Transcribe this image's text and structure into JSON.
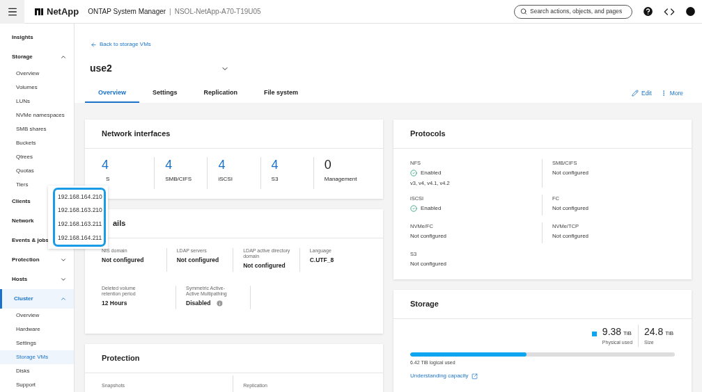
{
  "header": {
    "brand": "NetApp",
    "product": "ONTAP System Manager",
    "separator": "|",
    "cluster": "NSOL-NetApp-A70-T19U05",
    "search": {
      "placeholder": "Search actions, objects, and pages"
    }
  },
  "sidebar": {
    "items": [
      {
        "label": "Insights",
        "selected": false
      },
      {
        "label": "Storage",
        "selected": false,
        "expanded": true,
        "children": [
          {
            "label": "Overview",
            "selected": false
          },
          {
            "label": "Volumes",
            "selected": false
          },
          {
            "label": "LUNs",
            "selected": false
          },
          {
            "label": "NVMe namespaces",
            "selected": false
          },
          {
            "label": "SMB shares",
            "selected": false
          },
          {
            "label": "Buckets",
            "selected": false
          },
          {
            "label": "Qtrees",
            "selected": false
          },
          {
            "label": "Quotas",
            "selected": false
          },
          {
            "label": "Tiers",
            "selected": false
          }
        ]
      },
      {
        "label": "Clients",
        "selected": false
      },
      {
        "label": "Network",
        "selected": false
      },
      {
        "label": "Events & jobs",
        "selected": false
      },
      {
        "label": "Protection",
        "selected": false,
        "expanded": false
      },
      {
        "label": "Hosts",
        "selected": false,
        "expanded": false
      },
      {
        "label": "Cluster",
        "selected": true,
        "expanded": true,
        "children": [
          {
            "label": "Overview",
            "selected": false
          },
          {
            "label": "Hardware",
            "selected": false
          },
          {
            "label": "Settings",
            "selected": false
          },
          {
            "label": "Storage VMs",
            "selected": true
          },
          {
            "label": "Disks",
            "selected": false
          },
          {
            "label": "Support",
            "selected": false
          }
        ]
      }
    ]
  },
  "page": {
    "back_link": "Back to storage VMs",
    "title": "use2",
    "tabs": [
      {
        "label": "Overview",
        "selected": true
      },
      {
        "label": "Settings",
        "selected": false
      },
      {
        "label": "Replication",
        "selected": false
      },
      {
        "label": "File system",
        "selected": false
      }
    ],
    "actions": [
      {
        "kind": "edit",
        "label": "Edit"
      },
      {
        "kind": "more",
        "label": "More"
      }
    ]
  },
  "network_interfaces": {
    "title": "Network interfaces",
    "items": [
      {
        "count": "4",
        "label": "S",
        "clickable": true
      },
      {
        "count": "4",
        "label": "SMB/CIFS",
        "clickable": true
      },
      {
        "count": "4",
        "label": "iSCSI",
        "clickable": true
      },
      {
        "count": "4",
        "label": "S3",
        "clickable": true
      },
      {
        "count": "0",
        "label": "Management",
        "clickable": false
      }
    ]
  },
  "popup": {
    "addresses": [
      "192.168.164.210",
      "192.168.163.210",
      "192.168.163.211",
      "192.168.164.211"
    ]
  },
  "details": {
    "title": "ails",
    "rows": [
      [
        {
          "label": "NIS domain",
          "value": "Not configured"
        },
        {
          "label": "LDAP servers",
          "value": "Not configured"
        },
        {
          "label": "LDAP active directory domain",
          "value": "Not configured"
        },
        {
          "label": "Language",
          "value": "C.UTF_8"
        }
      ],
      [
        {
          "label": "Deleted volume retention period",
          "value": "12 Hours"
        },
        {
          "label": "Symmetric Active-Active Multipathing",
          "value": "Disabled",
          "info": true
        }
      ]
    ]
  },
  "protection": {
    "title": "Protection",
    "fields": [
      "Snapshots",
      "Replication"
    ]
  },
  "protocols": {
    "title": "Protocols",
    "items": [
      {
        "name": "NFS",
        "status": "Enabled",
        "enabled": true,
        "detail": "v3, v4, v4.1, v4.2"
      },
      {
        "name": "SMB/CIFS",
        "status": "Not configured",
        "enabled": false
      },
      {
        "name": "iSCSI",
        "status": "Enabled",
        "enabled": true
      },
      {
        "name": "FC",
        "status": "Not configured",
        "enabled": false
      },
      {
        "name": "NVMe/FC",
        "status": "Not configured",
        "enabled": false
      },
      {
        "name": "NVMe/TCP",
        "status": "Not configured",
        "enabled": false
      },
      {
        "name": "S3",
        "status": "Not configured",
        "enabled": false
      }
    ]
  },
  "storage": {
    "title": "Storage",
    "used": {
      "value": "9.38",
      "unit": "TiB",
      "label": "Physical used",
      "color": "#0ea5f0"
    },
    "size": {
      "value": "24.8",
      "unit": "TiB",
      "label": "Size"
    },
    "level": 0.44,
    "logical": "6.42 TiB logical used",
    "link": "Understanding capacity"
  }
}
